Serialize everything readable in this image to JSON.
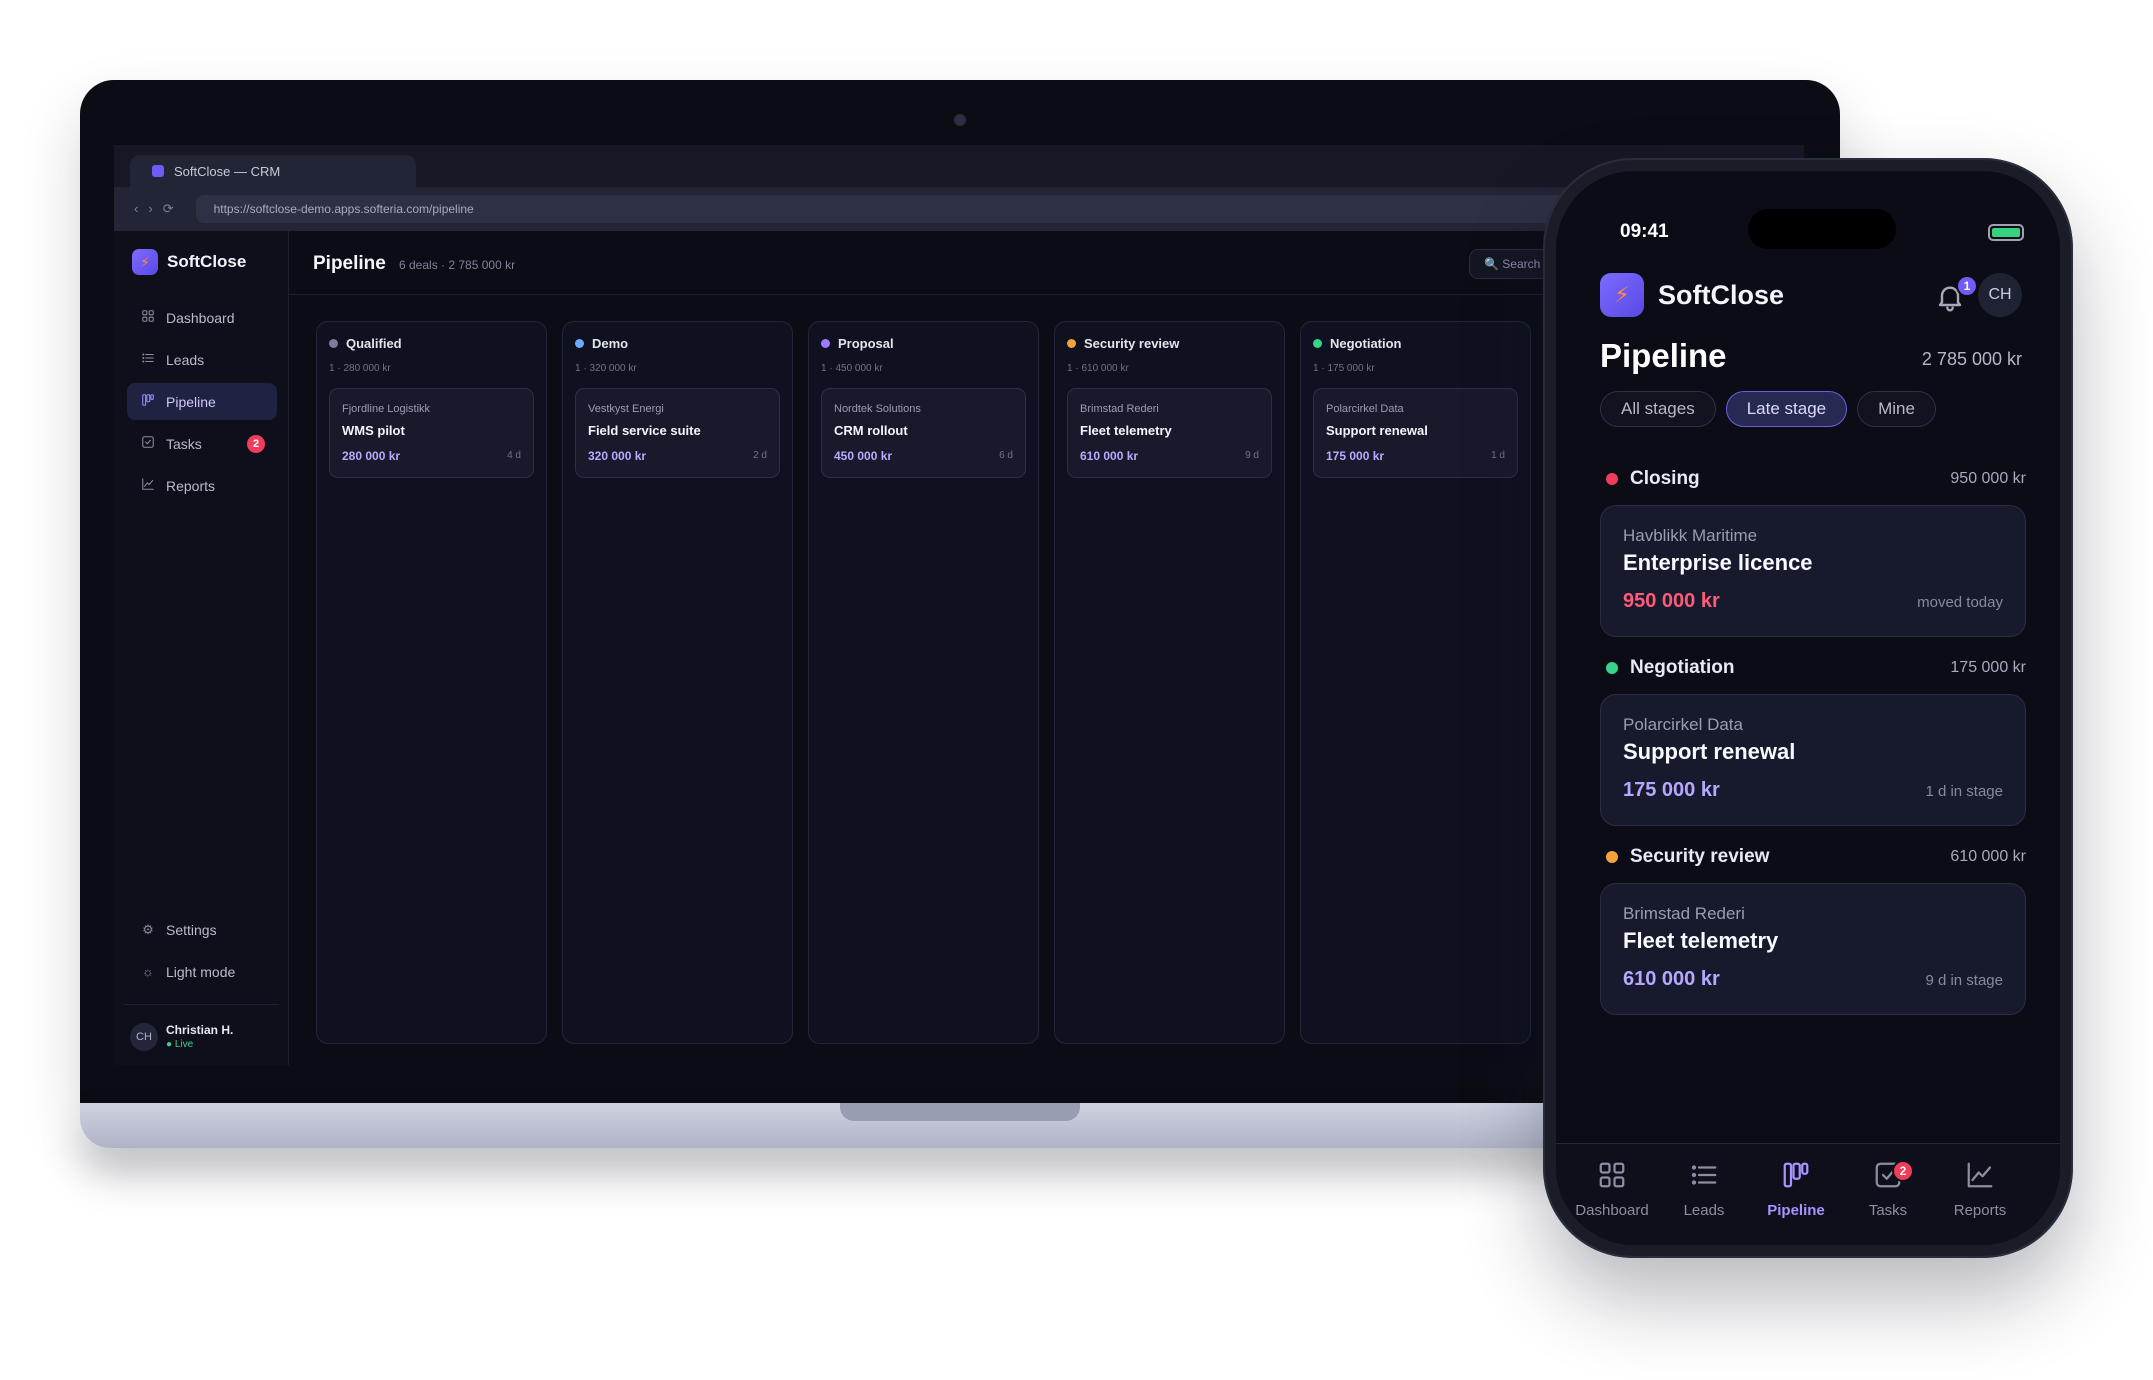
{
  "browser": {
    "tab_title": "SoftClose — CRM",
    "url": "https://softclose-demo.apps.softeria.com/pipeline",
    "back_glyph": "‹",
    "forward_glyph": "›",
    "reload_glyph": "⟳"
  },
  "desktop": {
    "brand": "SoftClose",
    "nav": [
      {
        "label": "Dashboard",
        "icon": "grid-icon"
      },
      {
        "label": "Leads",
        "icon": "list-icon"
      },
      {
        "label": "Pipeline",
        "icon": "kanban-icon",
        "active": true
      },
      {
        "label": "Tasks",
        "icon": "check-square-icon",
        "badge": "2"
      },
      {
        "label": "Reports",
        "icon": "chart-line-icon"
      }
    ],
    "settings_label": "Settings",
    "light_mode_label": "Light mode",
    "user": {
      "initials": "CH",
      "name": "Christian H.",
      "status": "● Live"
    },
    "page_title": "Pipeline",
    "page_sub": "6 deals · 2 785 000 kr",
    "search_placeholder": "🔍  Search",
    "columns": [
      {
        "stage": "Qualified",
        "dot": "#7b7f95",
        "meta": "1 · 280 000 kr",
        "card": {
          "company": "Fjordline Logistikk",
          "title": "WMS pilot",
          "value": "280 000 kr",
          "days": "4 d"
        }
      },
      {
        "stage": "Demo",
        "dot": "#6fa8ff",
        "meta": "1 · 320 000 kr",
        "card": {
          "company": "Vestkyst Energi",
          "title": "Field service suite",
          "value": "320 000 kr",
          "days": "2 d"
        }
      },
      {
        "stage": "Proposal",
        "dot": "#9b7bff",
        "meta": "1 · 450 000 kr",
        "card": {
          "company": "Nordtek Solutions",
          "title": "CRM rollout",
          "value": "450 000 kr",
          "days": "6 d"
        }
      },
      {
        "stage": "Security review",
        "dot": "#f5a23a",
        "meta": "1 · 610 000 kr",
        "card": {
          "company": "Brimstad Rederi",
          "title": "Fleet telemetry",
          "value": "610 000 kr",
          "days": "9 d"
        }
      },
      {
        "stage": "Negotiation",
        "dot": "#36d38a",
        "meta": "1 · 175 000 kr",
        "card": {
          "company": "Polarcirkel Data",
          "title": "Support renewal",
          "value": "175 000 kr",
          "days": "1 d"
        }
      }
    ]
  },
  "phone": {
    "time": "09:41",
    "brand": "SoftClose",
    "bell_badge": "1",
    "avatar": "CH",
    "title": "Pipeline",
    "total": "2 785 000 kr",
    "chips": [
      "All stages",
      "Late stage",
      "Mine"
    ],
    "active_chip": 1,
    "sections": [
      {
        "stage": "Closing",
        "dot": "#ef3d5b",
        "amount": "950 000 kr",
        "card": {
          "company": "Havblikk Maritime",
          "title": "Enterprise licence",
          "value": "950 000 kr",
          "note": "moved today",
          "hot": true
        }
      },
      {
        "stage": "Negotiation",
        "dot": "#36d38a",
        "amount": "175 000 kr",
        "card": {
          "company": "Polarcirkel Data",
          "title": "Support renewal",
          "value": "175 000 kr",
          "note": "1 d in stage",
          "hot": false
        }
      },
      {
        "stage": "Security review",
        "dot": "#f5a23a",
        "amount": "610 000 kr",
        "card": {
          "company": "Brimstad Rederi",
          "title": "Fleet telemetry",
          "value": "610 000 kr",
          "note": "9 d in stage",
          "hot": false
        }
      }
    ],
    "tabs": [
      {
        "label": "Dashboard",
        "icon": "grid-icon"
      },
      {
        "label": "Leads",
        "icon": "list-icon"
      },
      {
        "label": "Pipeline",
        "icon": "kanban-icon",
        "active": true
      },
      {
        "label": "Tasks",
        "icon": "check-square-icon",
        "badge": "2"
      },
      {
        "label": "Reports",
        "icon": "chart-line-icon"
      }
    ]
  },
  "colors": {
    "accent": "#6d5cf6",
    "badge": "#ef3d5b",
    "live": "#36d38a"
  }
}
